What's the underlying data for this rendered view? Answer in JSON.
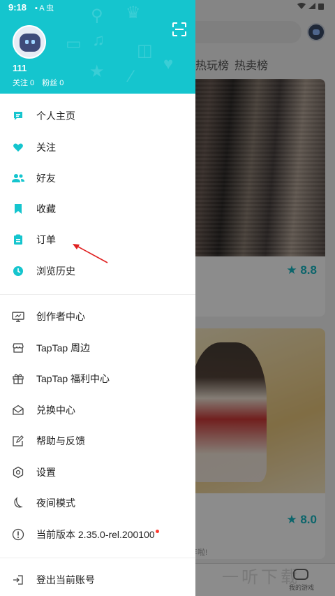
{
  "status_bar": {
    "time": "9:18",
    "icons_left": "▪ A 虫"
  },
  "header": {
    "username": "111",
    "following_label": "关注 0",
    "followers_label": "粉丝 0"
  },
  "menu": {
    "section1": [
      {
        "label": "个人主页",
        "icon": "profile-icon"
      },
      {
        "label": "关注",
        "icon": "heart-icon"
      },
      {
        "label": "好友",
        "icon": "friends-icon"
      },
      {
        "label": "收藏",
        "icon": "bookmark-icon"
      },
      {
        "label": "订单",
        "icon": "clipboard-icon"
      },
      {
        "label": "浏览历史",
        "icon": "clock-icon"
      }
    ],
    "section2": [
      {
        "label": "创作者中心",
        "icon": "monitor-icon"
      },
      {
        "label": "TapTap 周边",
        "icon": "shop-icon"
      },
      {
        "label": "TapTap 福利中心",
        "icon": "gift-icon"
      },
      {
        "label": "兑换中心",
        "icon": "mail-icon"
      },
      {
        "label": "帮助与反馈",
        "icon": "edit-icon"
      },
      {
        "label": "设置",
        "icon": "settings-icon"
      },
      {
        "label": "夜间模式",
        "icon": "moon-icon"
      },
      {
        "label": "当前版本 2.35.0-rel.200100",
        "icon": "info-icon"
      }
    ],
    "logout": {
      "label": "登出当前账号",
      "icon": "logout-icon"
    }
  },
  "background": {
    "tab_1": "热玩榜",
    "tab_2": "热卖榜",
    "rating_1": "★ 8.8",
    "rating_2": "★ 8.0",
    "card_2_note": "年啦!",
    "bottom_label": "我的游戏",
    "watermark": "一听下载"
  },
  "colors": {
    "accent": "#15c5ce",
    "annotation": "#e02020"
  }
}
